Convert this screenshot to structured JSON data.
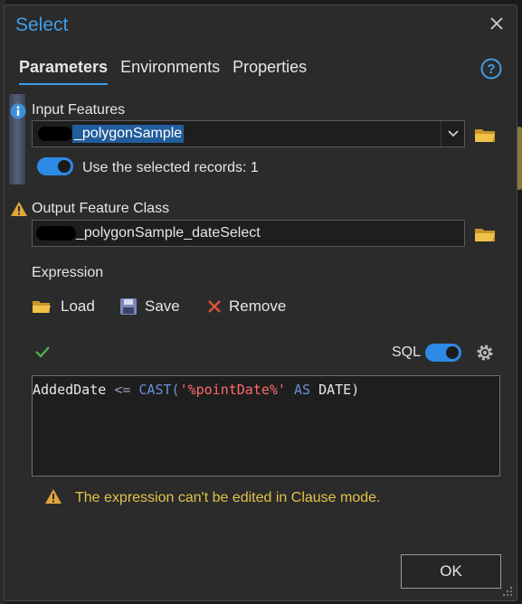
{
  "dialog": {
    "title": "Select",
    "tabs": [
      "Parameters",
      "Environments",
      "Properties"
    ],
    "active_tab": "Parameters"
  },
  "input_features": {
    "label": "Input Features",
    "value": "_polygonSample",
    "use_selected_label": "Use the selected records: 1",
    "use_selected_on": true
  },
  "output": {
    "label": "Output Feature Class",
    "value": "_polygonSample_dateSelect"
  },
  "expression": {
    "label": "Expression",
    "load_label": "Load",
    "save_label": "Save",
    "remove_label": "Remove",
    "sql_label": "SQL",
    "sql_on": true,
    "sql_tokens": {
      "field": "AddedDate",
      "op": "<=",
      "fn": "CAST(",
      "str": "'%pointDate%'",
      "as": "AS",
      "type": "DATE)"
    },
    "warning": "The expression can't be edited in Clause mode."
  },
  "footer": {
    "ok_label": "OK"
  },
  "colors": {
    "accent": "#3f9de8",
    "toggle": "#2d8ae6",
    "warning": "#e2c34a",
    "folder": "#e8b83a",
    "remove": "#e0533a"
  }
}
